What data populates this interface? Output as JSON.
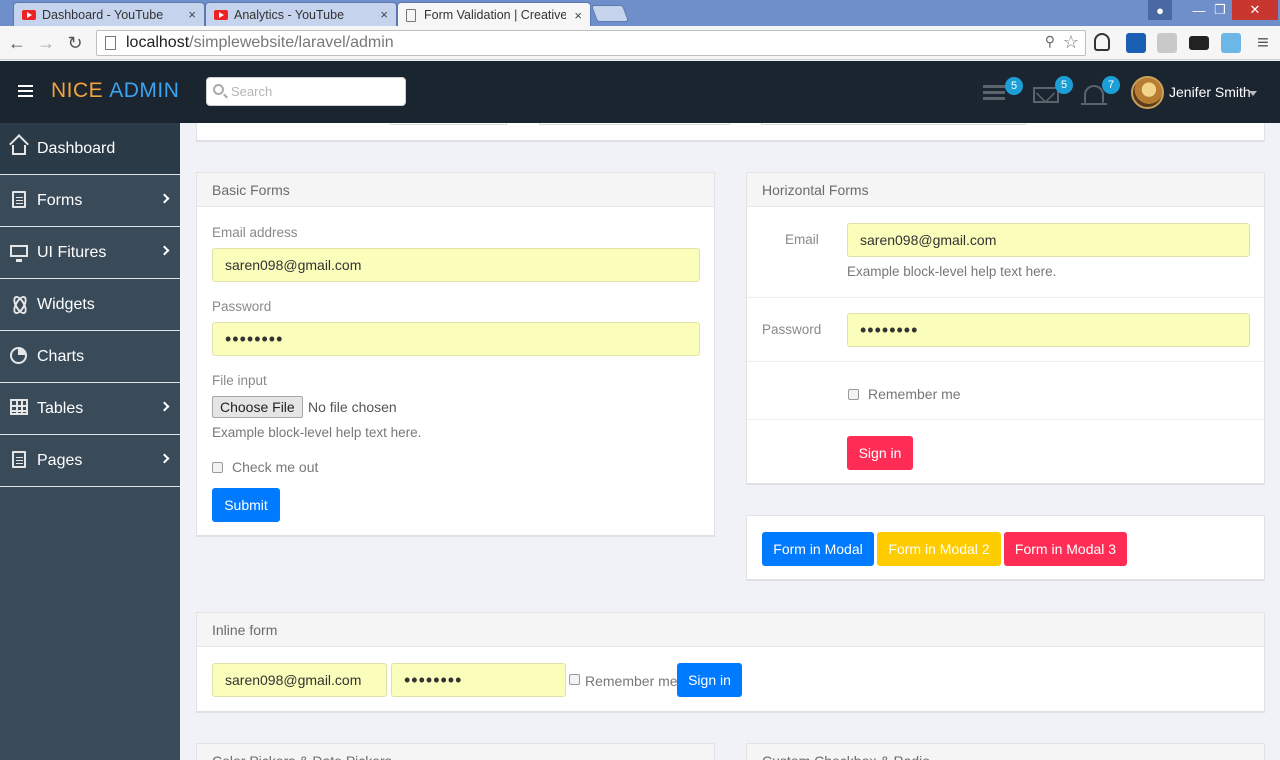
{
  "browser": {
    "tabs": [
      {
        "title": "Dashboard - YouTube"
      },
      {
        "title": "Analytics - YouTube"
      },
      {
        "title": "Form Validation | Creative"
      }
    ],
    "close_glyph": "×",
    "url_host": "localhost",
    "url_path": "/simplewebsite/laravel/admin",
    "win_min": "—",
    "win_max": "❐",
    "win_close": "✕",
    "back_glyph": "←",
    "forward_glyph": "→",
    "reload_glyph": "↻",
    "star_glyph": "☆",
    "menu_glyph": "≡"
  },
  "header": {
    "logo_part1": "NICE",
    "logo_part2": "ADMIN",
    "search_placeholder": "Search",
    "tasks_count": "5",
    "mail_count": "5",
    "notif_count": "7",
    "user_name": "Jenifer Smith",
    "accent_color": "#3ba3f0",
    "logo_color": "#f3a33c"
  },
  "sidebar": {
    "items": [
      {
        "label": "Dashboard"
      },
      {
        "label": "Forms"
      },
      {
        "label": "UI Fitures"
      },
      {
        "label": "Widgets"
      },
      {
        "label": "Charts"
      },
      {
        "label": "Tables"
      },
      {
        "label": "Pages"
      }
    ]
  },
  "basic_forms": {
    "title": "Basic Forms",
    "email_label": "Email address",
    "email_value": "saren098@gmail.com",
    "password_label": "Password",
    "password_value": "••••••••",
    "file_label": "File input",
    "file_button": "Choose File",
    "file_status": "No file chosen",
    "help_text": "Example block-level help text here.",
    "check_label": "Check me out",
    "submit_label": "Submit"
  },
  "horizontal_forms": {
    "title": "Horizontal Forms",
    "email_label": "Email",
    "email_value": "saren098@gmail.com",
    "help_text": "Example block-level help text here.",
    "password_label": "Password",
    "password_value": "••••••••",
    "remember_label": "Remember me",
    "signin_label": "Sign in"
  },
  "modal_buttons": {
    "modal1": "Form in Modal",
    "modal2": "Form in Modal 2",
    "modal3": "Form in Modal 3"
  },
  "inline_form": {
    "title": "Inline form",
    "email_value": "saren098@gmail.com",
    "password_value": "••••••••",
    "remember_label": "Remember me",
    "signin_label": "Sign in"
  },
  "bottom_panels": {
    "left_title": "Color Pickers & Date Pickers",
    "right_title": "Custom Checkbox & Radio"
  }
}
